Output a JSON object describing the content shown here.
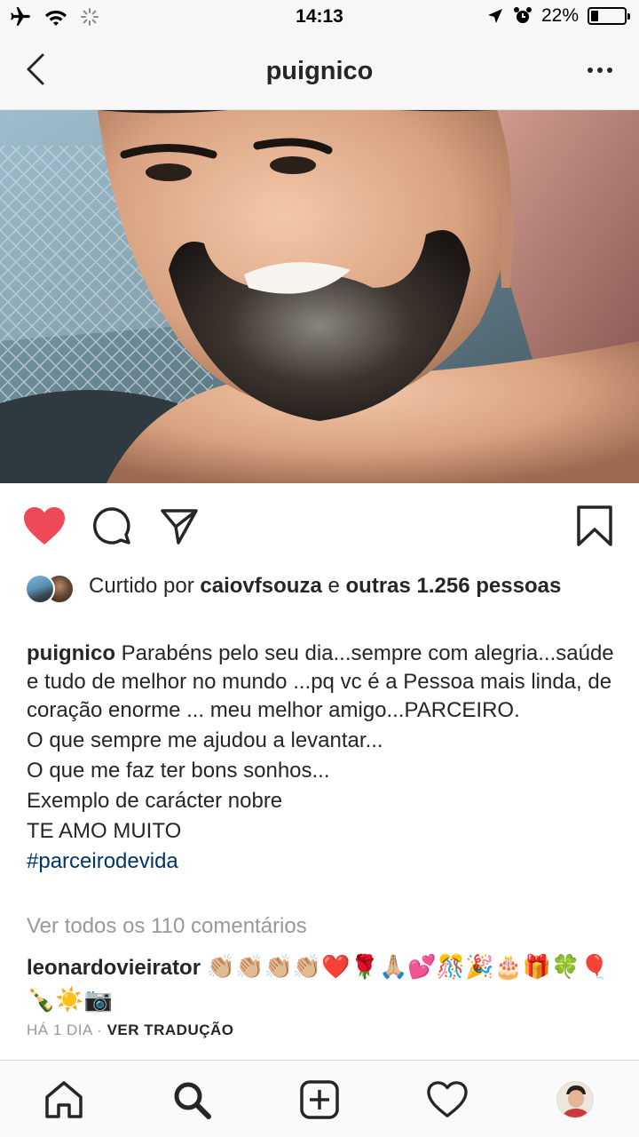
{
  "status_bar": {
    "time": "14:13",
    "battery_label": "22%",
    "battery_level": 0.22,
    "icons": [
      "airplane-icon",
      "wifi-icon",
      "activity-icon",
      "location-arrow-icon",
      "alarm-icon",
      "battery-icon"
    ]
  },
  "header": {
    "title": "puignico",
    "icons": [
      "back-chevron-icon",
      "more-dots-icon"
    ]
  },
  "post": {
    "actions": [
      "heart-filled-icon",
      "comment-icon",
      "share-icon",
      "bookmark-icon"
    ],
    "colors": {
      "like": "#ed4956",
      "hashtag": "#003569",
      "muted": "#999999",
      "text": "#262626"
    },
    "likes": {
      "prefix": "Curtido por",
      "user": "caiovfsouza",
      "connector": "e",
      "others": "outras 1.256 pessoas"
    },
    "caption": {
      "user": "puignico",
      "first": "Parabéns pelo seu dia...sempre com alegria...saúde e tudo de melhor no mundo ...pq vc é a Pessoa mais linda, de coração enorme ... meu melhor amigo...PARCEIRO.",
      "line2": "O que sempre me ajudou a levantar...",
      "line3": "O que me faz ter bons sonhos...",
      "line4": "Exemplo de carácter nobre",
      "line5": "TE AMO MUITO",
      "hashtag": "#parceirodevida"
    },
    "view_all_comments": "Ver todos os 110 comentários",
    "comment": {
      "user": "leonardovieirator",
      "text": "👏🏼👏🏼👏🏼👏🏼❤️🌹🙏🏼💕🎊🎉🎂🎁🍀🎈🍾☀️📷"
    },
    "time_ago": "HÁ 1 DIA",
    "separator": "·",
    "translate": "VER TRADUÇÃO"
  },
  "tab_bar": {
    "items": [
      "home-icon",
      "search-icon",
      "new-post-icon",
      "activity-heart-icon",
      "profile-avatar"
    ]
  }
}
